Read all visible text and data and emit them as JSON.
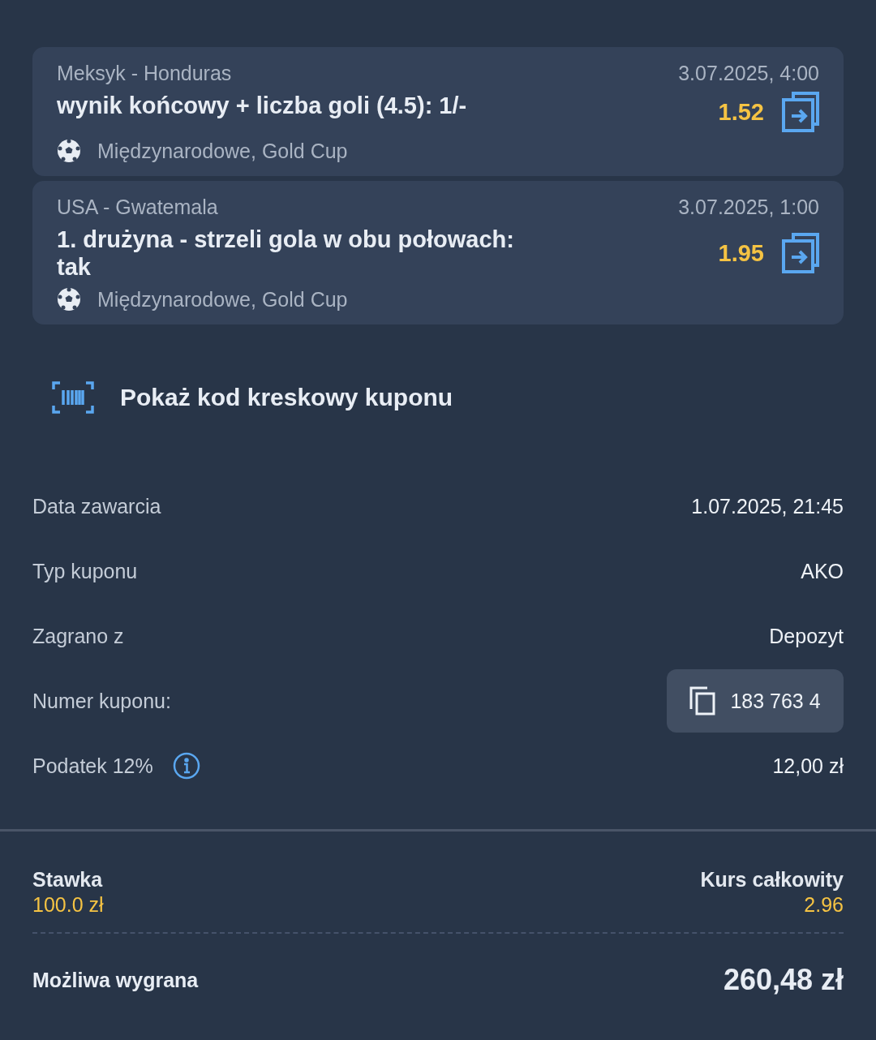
{
  "bets": [
    {
      "match": "Meksyk - Honduras",
      "datetime": "3.07.2025, 4:00",
      "market": "wynik końcowy + liczba goli (4.5): 1/-",
      "odds": "1.52",
      "league": "Międzynarodowe, Gold Cup"
    },
    {
      "match": "USA - Gwatemala",
      "datetime": "3.07.2025, 1:00",
      "market": "1. drużyna - strzeli gola w obu połowach: tak",
      "odds": "1.95",
      "league": "Międzynarodowe, Gold Cup"
    }
  ],
  "barcode_link": "Pokaż kod kreskowy kuponu",
  "details": [
    {
      "kind": "text",
      "label": "Data zawarcia",
      "value": "1.07.2025, 21:45"
    },
    {
      "kind": "text",
      "label": "Typ kuponu",
      "value": "AKO"
    },
    {
      "kind": "text",
      "label": "Zagrano z",
      "value": "Depozyt"
    },
    {
      "kind": "copy",
      "label": "Numer kuponu:",
      "value": "183 763 4"
    },
    {
      "kind": "info",
      "label": "Podatek 12%",
      "value": "12,00 zł"
    }
  ],
  "summary": {
    "stake_label": "Stawka",
    "stake": "100.0 zł",
    "odds_label": "Kurs całkowity",
    "odds": "2.96",
    "win_label": "Możliwa wygrana",
    "win": "260,48 zł"
  }
}
